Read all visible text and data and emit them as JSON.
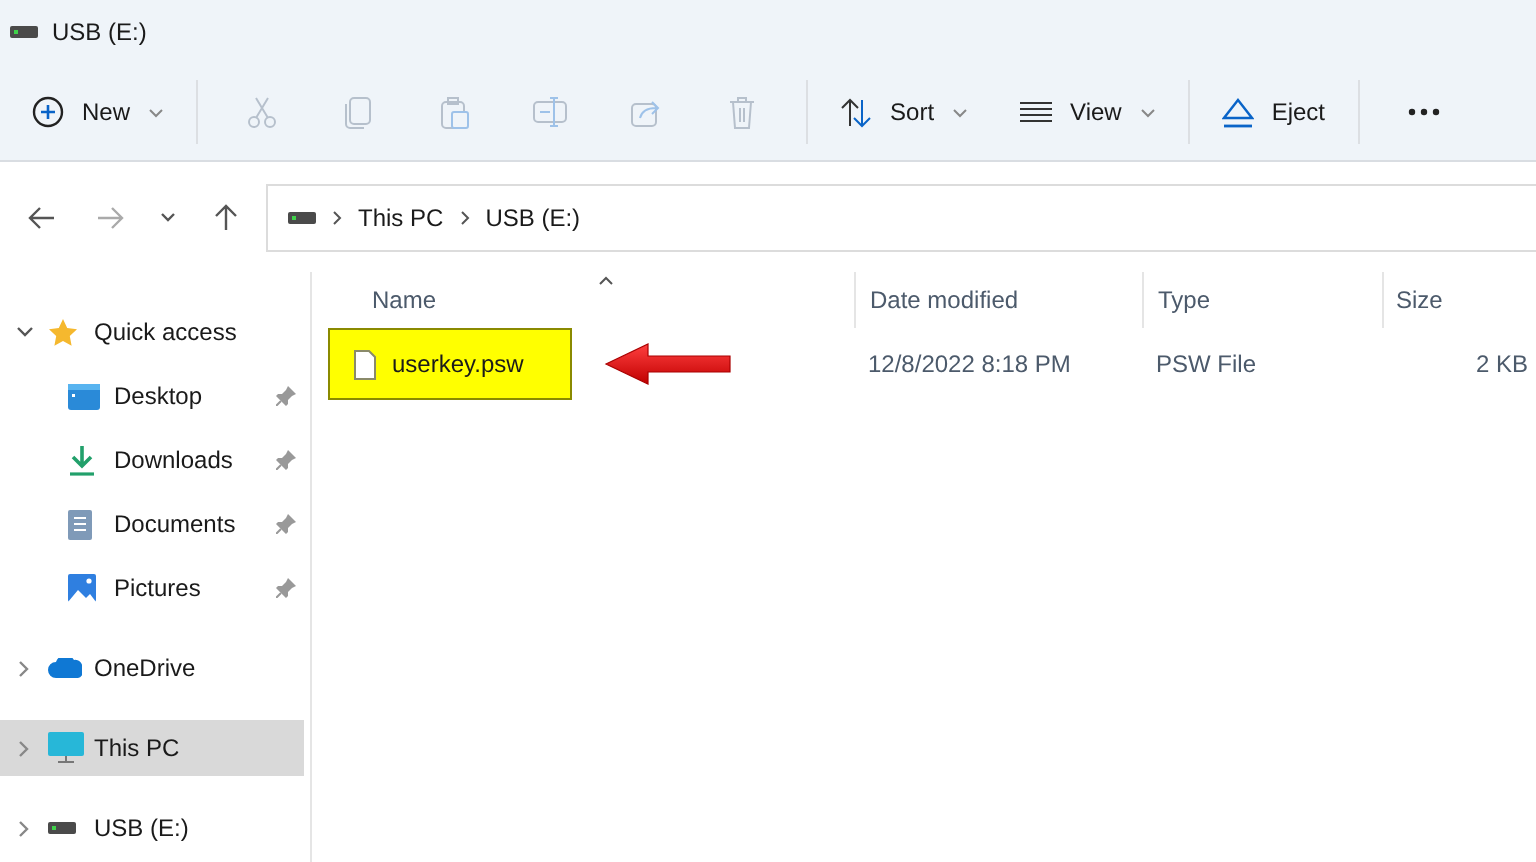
{
  "window": {
    "title": "USB (E:)"
  },
  "toolbar": [
    {
      "kind": "new",
      "label": "New",
      "disabled": false
    },
    {
      "kind": "cut",
      "disabled": true
    },
    {
      "kind": "copy",
      "disabled": true
    },
    {
      "kind": "paste",
      "disabled": true
    },
    {
      "kind": "rename",
      "disabled": true
    },
    {
      "kind": "share",
      "disabled": true
    },
    {
      "kind": "delete",
      "disabled": true
    },
    {
      "kind": "sort",
      "label": "Sort",
      "disabled": false
    },
    {
      "kind": "view",
      "label": "View",
      "disabled": false
    },
    {
      "kind": "eject",
      "label": "Eject",
      "disabled": false
    },
    {
      "kind": "more",
      "disabled": false
    }
  ],
  "navigation": [
    {
      "kind": "back",
      "disabled": false
    },
    {
      "kind": "forward",
      "disabled": true
    },
    {
      "kind": "recent",
      "disabled": false
    },
    {
      "kind": "up",
      "disabled": false
    }
  ],
  "address_bar": {
    "path": [
      "This PC",
      "USB (E:)"
    ]
  },
  "sidebar": {
    "items": [
      {
        "kind": "quick",
        "label": "Quick access",
        "expanded": true,
        "selected": false,
        "children": [
          {
            "kind": "desktop",
            "label": "Desktop",
            "pinned": true,
            "selected": false
          },
          {
            "kind": "downloads",
            "label": "Downloads",
            "pinned": true,
            "selected": false
          },
          {
            "kind": "documents",
            "label": "Documents",
            "pinned": true,
            "selected": false
          },
          {
            "kind": "pictures",
            "label": "Pictures",
            "pinned": true,
            "selected": false
          }
        ]
      },
      {
        "kind": "onedrive",
        "label": "OneDrive",
        "expanded": false,
        "selected": false
      },
      {
        "kind": "pc",
        "label": "This PC",
        "expanded": false,
        "selected": true
      },
      {
        "kind": "usb",
        "label": "USB (E:)",
        "expanded": false,
        "selected": false
      }
    ]
  },
  "table": {
    "columns": [
      {
        "label": "Name",
        "sorted": true
      },
      {
        "label": "Date modified",
        "sorted": false
      },
      {
        "label": "Type",
        "sorted": false
      },
      {
        "label": "Size",
        "sorted": false
      }
    ],
    "rows": [
      {
        "name": "userkey.psw",
        "date": "12/8/2022 8:18 PM",
        "type": "PSW File",
        "size": "2 KB",
        "highlighted": true
      }
    ]
  }
}
